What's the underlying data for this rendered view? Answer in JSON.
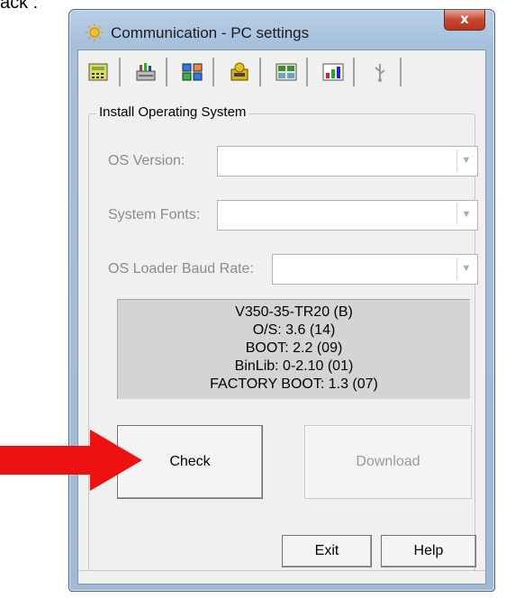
{
  "caption": "ack :",
  "window": {
    "title": "Communication - PC settings",
    "close_label": "x"
  },
  "tabs": [
    {
      "icon": "calculator-icon"
    },
    {
      "icon": "plc-icon"
    },
    {
      "icon": "network-icon"
    },
    {
      "icon": "os-chip-icon"
    },
    {
      "icon": "grid-icon"
    },
    {
      "icon": "chart-icon"
    },
    {
      "icon": "usb-icon"
    }
  ],
  "group": {
    "legend": "Install Operating System",
    "os_version_label": "OS Version:",
    "os_version_value": "",
    "system_fonts_label": "System Fonts:",
    "system_fonts_value": "",
    "baud_rate_label": "OS Loader Baud Rate:",
    "baud_rate_value": ""
  },
  "info": [
    "V350-35-TR20 (B)",
    "O/S: 3.6 (14)",
    "BOOT: 2.2 (09)",
    "BinLib: 0-2.10 (01)",
    "FACTORY BOOT: 1.3 (07)"
  ],
  "buttons": {
    "check": "Check",
    "download": "Download",
    "exit": "Exit",
    "help": "Help"
  },
  "colors": {
    "arrow": "#ee1111",
    "info_bg": "#d4d4d4",
    "close": "#c9462f"
  }
}
